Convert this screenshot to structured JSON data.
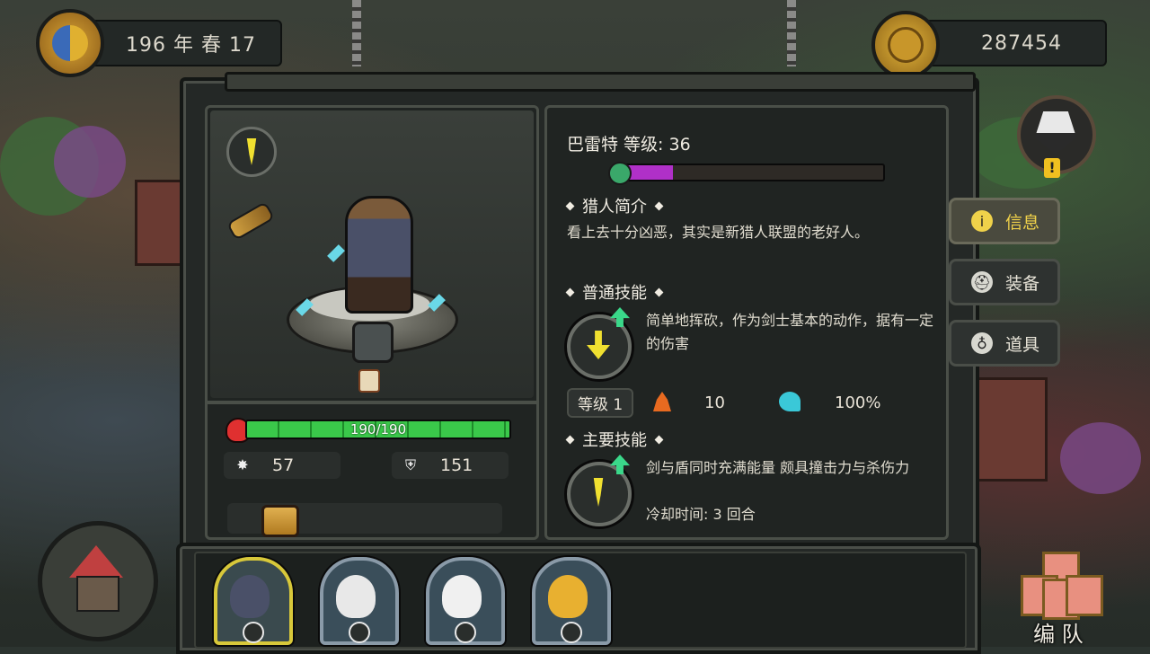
{
  "top_left": {
    "date": "196 年 春 17",
    "emblem_icon": "season-moon-icon"
  },
  "top_right": {
    "coins": "287454",
    "coin_icon": "gold-coin-icon"
  },
  "hero": {
    "hp": "190/190",
    "hp_fraction": 1.0,
    "attack": "57",
    "defense": "151"
  },
  "info": {
    "name_level": "巴雷特  等级: 36",
    "xp_fraction": 0.2,
    "profile_title": "猎人简介",
    "profile_text": "看上去十分凶恶，其实是新猎人联盟的老好人。",
    "normal_skill_title": "普通技能",
    "normal_skill_desc": "简单地挥砍，作为剑士基本的动作，据有一定的伤害",
    "skill_level": "等级 1",
    "skill_fire": "10",
    "skill_crit": "100%",
    "main_skill_title": "主要技能",
    "main_skill_desc": "剑与盾同时充满能量 颇具撞击力与杀伤力",
    "main_skill_cooldown": "冷却时间: 3 回合"
  },
  "side_tabs": [
    {
      "label": "信息",
      "icon": "info-icon",
      "active": true
    },
    {
      "label": "装备",
      "icon": "helmet-icon",
      "active": false
    },
    {
      "label": "道具",
      "icon": "potion-icon",
      "active": false
    }
  ],
  "roster": [
    {
      "name": "barrett-boar",
      "color": "#4a5068",
      "selected": true
    },
    {
      "name": "eagle",
      "color": "#e8e8e8",
      "selected": false
    },
    {
      "name": "polar-bear",
      "color": "#f0f0f0",
      "selected": false
    },
    {
      "name": "leopard",
      "color": "#e8b030",
      "selected": false
    }
  ],
  "formation_label": "编 队",
  "colors": {
    "accent": "#f0d24a",
    "hp": "#3ac84a",
    "xp": "#b030c8"
  }
}
